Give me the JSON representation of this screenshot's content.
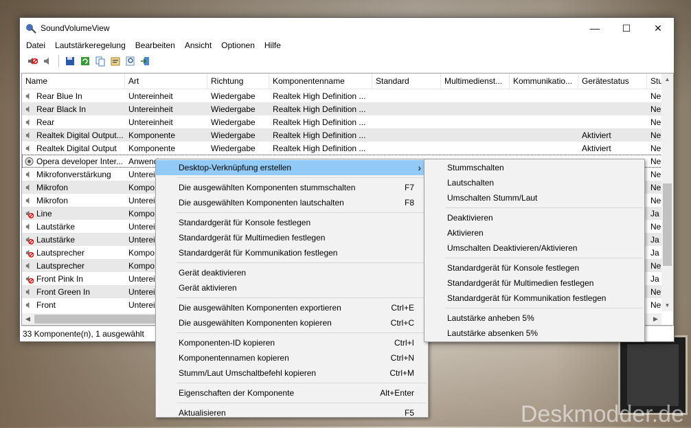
{
  "window": {
    "title": "SoundVolumeView",
    "min_icon": "minimize-icon",
    "max_icon": "maximize-icon",
    "close_icon": "close-icon"
  },
  "menu": [
    "Datei",
    "Lautstärkeregelung",
    "Bearbeiten",
    "Ansicht",
    "Optionen",
    "Hilfe"
  ],
  "columns": [
    "Name",
    "Art",
    "Richtung",
    "Komponentenname",
    "Standard",
    "Multimediensst...",
    "Kommunikatio...",
    "Gerätestatus",
    "Stu"
  ],
  "columns_display": {
    "name": "Name",
    "art": "Art",
    "richtung": "Richtung",
    "komp": "Komponentenname",
    "std": "Standard",
    "mm": "Multimedienst...",
    "komm": "Kommunikatio...",
    "gs": "Gerätestatus",
    "stu": "Stu"
  },
  "rows": [
    {
      "name": "Rear Blue In",
      "art": "Untereinheit",
      "richtung": "Wiedergabe",
      "komp": "Realtek High Definition ...",
      "gs": "",
      "stu": "Nei"
    },
    {
      "name": "Rear Black In",
      "art": "Untereinheit",
      "richtung": "Wiedergabe",
      "komp": "Realtek High Definition ...",
      "gs": "",
      "stu": "Nei"
    },
    {
      "name": "Rear",
      "art": "Untereinheit",
      "richtung": "Wiedergabe",
      "komp": "Realtek High Definition ...",
      "gs": "",
      "stu": "Nei"
    },
    {
      "name": "Realtek Digital Output...",
      "art": "Komponente",
      "richtung": "Wiedergabe",
      "komp": "Realtek High Definition ...",
      "gs": "Aktiviert",
      "stu": "Nei"
    },
    {
      "name": "Realtek Digital Output",
      "art": "Komponente",
      "richtung": "Wiedergabe",
      "komp": "Realtek High Definition ...",
      "gs": "Aktiviert",
      "stu": "Nei"
    },
    {
      "name": "Opera developer Inter...",
      "art": "Anwend",
      "richtung": "",
      "komp": "",
      "gs": "",
      "stu": "Nei"
    },
    {
      "name": "Mikrofonverstärkung",
      "art": "Untereir",
      "richtung": "",
      "komp": "",
      "gs": "",
      "stu": "Nei"
    },
    {
      "name": "Mikrofon",
      "art": "Kompo",
      "richtung": "",
      "komp": "",
      "gs": "",
      "stu": "Nei"
    },
    {
      "name": "Mikrofon",
      "art": "Untereir",
      "richtung": "",
      "komp": "",
      "gs": "",
      "stu": "Nei"
    },
    {
      "name": "Line",
      "art": "Kompo",
      "richtung": "",
      "komp": "",
      "gs": "",
      "stu": "Ja"
    },
    {
      "name": "Lautstärke",
      "art": "Untereir",
      "richtung": "",
      "komp": "",
      "gs": "",
      "stu": "Nei"
    },
    {
      "name": "Lautstärke",
      "art": "Untereir",
      "richtung": "",
      "komp": "",
      "gs": "",
      "stu": "Ja"
    },
    {
      "name": "Lautsprecher",
      "art": "Kompo",
      "richtung": "",
      "komp": "",
      "gs": "",
      "stu": "Ja"
    },
    {
      "name": "Lautsprecher",
      "art": "Kompo",
      "richtung": "",
      "komp": "",
      "gs": "",
      "stu": "Nei"
    },
    {
      "name": "Front Pink In",
      "art": "Untereir",
      "richtung": "",
      "komp": "",
      "gs": "",
      "stu": "Ja"
    },
    {
      "name": "Front Green In",
      "art": "Untereir",
      "richtung": "",
      "komp": "",
      "gs": "",
      "stu": "Nei"
    },
    {
      "name": "Front",
      "art": "Untereir",
      "richtung": "",
      "komp": "",
      "gs": "",
      "stu": "Nei"
    }
  ],
  "status": "33 Komponente(n), 1 ausgewählt",
  "context_menu": {
    "items": [
      {
        "label": "Desktop-Verknüpfung erstellen",
        "shortcut": "",
        "submenu": true
      },
      {
        "label": "Die ausgewählten Komponenten stummschalten",
        "shortcut": "F7"
      },
      {
        "label": "Die ausgewählten Komponenten lautschalten",
        "shortcut": "F8"
      },
      {
        "label": "Standardgerät für Konsole festlegen",
        "shortcut": ""
      },
      {
        "label": "Standardgerät für Multimedien festlegen",
        "shortcut": ""
      },
      {
        "label": "Standardgerät für Kommunikation festlegen",
        "shortcut": ""
      },
      {
        "label": "Gerät deaktivieren",
        "shortcut": ""
      },
      {
        "label": "Gerät aktivieren",
        "shortcut": ""
      },
      {
        "label": "Die ausgewählten Komponenten exportieren",
        "shortcut": "Ctrl+E"
      },
      {
        "label": "Die ausgewählten Komponenten kopieren",
        "shortcut": "Ctrl+C"
      },
      {
        "label": "Komponenten-ID kopieren",
        "shortcut": "Ctrl+I"
      },
      {
        "label": "Komponentennamen kopieren",
        "shortcut": "Ctrl+N"
      },
      {
        "label": "Stumm/Laut Umschaltbefehl kopieren",
        "shortcut": "Ctrl+M"
      },
      {
        "label": "Eigenschaften der Komponente",
        "shortcut": "Alt+Enter"
      },
      {
        "label": "Aktualisieren",
        "shortcut": "F5"
      }
    ]
  },
  "submenu": {
    "items": [
      "Stummschalten",
      "Lautschalten",
      "Umschalten Stumm/Laut",
      "Deaktivieren",
      "Aktivieren",
      "Umschalten Deaktivieren/Aktivieren",
      "Standardgerät für Konsole festlegen",
      "Standardgerät für Multimedien festlegen",
      "Standardgerät für Kommunikation festlegen",
      "Lautstärke anheben 5%",
      "Lautstärke absenken 5%"
    ]
  },
  "watermark": "Deskmodder.de",
  "colors": {
    "highlight": "#91c9f7",
    "alt_row": "#e8e8e8"
  }
}
